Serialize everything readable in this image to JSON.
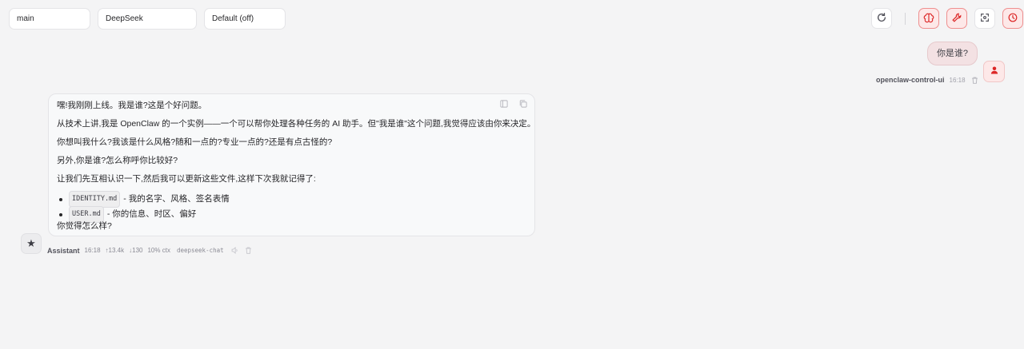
{
  "topbar": {
    "agent_select": "main",
    "model_select": "DeepSeek",
    "thinking_select": "Default (off)"
  },
  "user_message": {
    "text": "你是谁?",
    "sender": "openclaw-control-ui",
    "time": "16:18"
  },
  "assistant_message": {
    "paragraphs": [
      "嘿!我刚刚上线。我是谁?这是个好问题。",
      "从技术上讲,我是 OpenClaw 的一个实例——一个可以帮你处理各种任务的 AI 助手。但\"我是谁\"这个问题,我觉得应该由你来决定。",
      "你想叫我什么?我该是什么风格?随和一点的?专业一点的?还是有点古怪的?",
      "另外,你是谁?怎么称呼你比较好?",
      "让我们先互相认识一下,然后我可以更新这些文件,这样下次我就记得了:"
    ],
    "list": [
      {
        "code": "IDENTITY.md",
        "text": "- 我的名字、风格、签名表情"
      },
      {
        "code": "USER.md",
        "text": "- 你的信息、时区、偏好"
      }
    ],
    "closing": "你觉得怎么样?",
    "sender": "Assistant",
    "time": "16:18",
    "tokens_in": "↑13.4k",
    "tokens_out": "↓130",
    "context": "10% ctx",
    "model": "deepseek-chat"
  },
  "icons": {
    "refresh": "refresh-icon",
    "brain": "brain-icon",
    "tools": "wrench-icon",
    "focus": "focus-icon",
    "history": "clock-icon",
    "user_avatar": "user-icon",
    "assistant_avatar": "star-icon",
    "delete": "trash-icon"
  },
  "colors": {
    "accent": "#dc2626",
    "active_bg": "#fde8e8",
    "user_bubble": "#f3e1e3"
  }
}
